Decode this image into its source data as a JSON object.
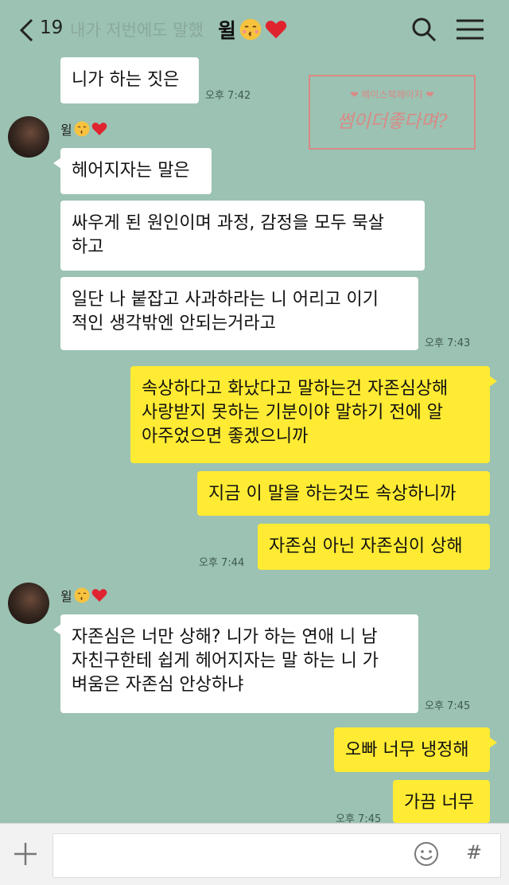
{
  "header": {
    "back_count": "19",
    "preview": "내가 저번에도 말했",
    "contact_name": "윌"
  },
  "stamp": {
    "line1": "❤ 페이스북페이지 ❤",
    "line2": "썸이더좋다며?"
  },
  "sender_name": "윌",
  "messages": [
    {
      "text": "니가 하는 짓은",
      "time": "오후 7:42"
    },
    {
      "text": "헤어지자는 말은"
    },
    {
      "text": "싸우게 된 원인이며 과정, 감정을 모두 묵살\n하고"
    },
    {
      "text": "일단 나 붙잡고 사과하라는 니 어리고 이기\n적인 생각밖엔 안되는거라고",
      "time": "오후 7:43"
    },
    {
      "text": "속상하다고 화났다고 말하는건 자존심상해\n사랑받지 못하는 기분이야 말하기 전에 알\n아주었으면 좋겠으니까"
    },
    {
      "text": "지금 이 말을 하는것도 속상하니까"
    },
    {
      "text": "자존심 아닌 자존심이 상해",
      "time": "오후 7:44"
    },
    {
      "text": "자존심은 너만 상해? 니가 하는 연애 니 남\n자친구한테 쉽게 헤어지자는 말 하는 니 가\n벼움은 자존심 안상하냐",
      "time": "오후 7:45"
    },
    {
      "text": "오빠 너무 냉정해"
    },
    {
      "text": "가끔 너무",
      "time": "오후 7:45"
    }
  ],
  "colors": {
    "background": "#9bc2b2",
    "my_bubble": "#ffeb33",
    "their_bubble": "#ffffff"
  }
}
